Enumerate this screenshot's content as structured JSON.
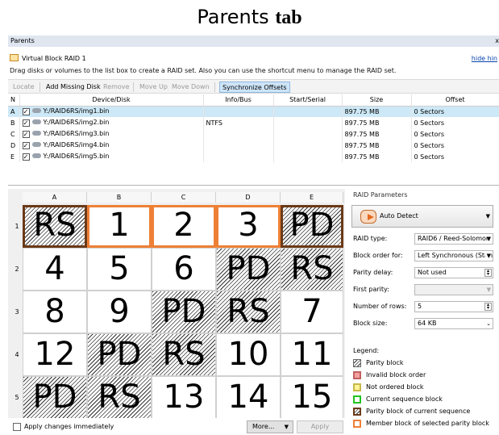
{
  "doc_title": {
    "part1": "Parents ",
    "part2": "tab"
  },
  "panel": {
    "title": "Parents",
    "close": "x"
  },
  "volume": {
    "name": "Virtual Block RAID 1",
    "hide_link": "hide hin"
  },
  "info_text": "Drag disks or volumes to the list box to create a RAID set. Also you can use the shortcut menu to manage the RAID set.",
  "toolbar": {
    "locate": "Locate",
    "add_missing": "Add Missing Disk",
    "remove": "Remove",
    "move_up": "Move Up",
    "move_down": "Move Down",
    "sync": "Synchronize Offsets"
  },
  "table": {
    "headers": {
      "n": "N",
      "device": "Device/Disk",
      "info": "Info/Bus",
      "start": "Start/Serial",
      "size": "Size",
      "offset": "Offset"
    },
    "rows": [
      {
        "n": "A",
        "device": "Y:/RAID6RS/img1.bin",
        "info": "",
        "start": "",
        "size": "897.75 MB",
        "offset": "0 Sectors"
      },
      {
        "n": "B",
        "device": "Y:/RAID6RS/img2.bin",
        "info": "NTFS",
        "start": "",
        "size": "897.75 MB",
        "offset": "0 Sectors"
      },
      {
        "n": "C",
        "device": "Y:/RAID6RS/img3.bin",
        "info": "",
        "start": "",
        "size": "897.75 MB",
        "offset": "0 Sectors"
      },
      {
        "n": "D",
        "device": "Y:/RAID6RS/img4.bin",
        "info": "",
        "start": "",
        "size": "897.75 MB",
        "offset": "0 Sectors"
      },
      {
        "n": "E",
        "device": "Y:/RAID6RS/img5.bin",
        "info": "",
        "start": "",
        "size": "897.75 MB",
        "offset": "0 Sectors"
      }
    ]
  },
  "grid": {
    "columns": [
      "A",
      "B",
      "C",
      "D",
      "E"
    ],
    "row_numbers": [
      "1",
      "2",
      "3",
      "4",
      "5"
    ],
    "rows": [
      [
        {
          "label": "RS",
          "kind": "curpar"
        },
        {
          "label": "1",
          "kind": "cur"
        },
        {
          "label": "2",
          "kind": "cur"
        },
        {
          "label": "3",
          "kind": "cur"
        },
        {
          "label": "PD",
          "kind": "curpar"
        }
      ],
      [
        {
          "label": "4",
          "kind": "data"
        },
        {
          "label": "5",
          "kind": "data"
        },
        {
          "label": "6",
          "kind": "data"
        },
        {
          "label": "PD",
          "kind": "parity"
        },
        {
          "label": "RS",
          "kind": "parity"
        }
      ],
      [
        {
          "label": "8",
          "kind": "data"
        },
        {
          "label": "9",
          "kind": "data"
        },
        {
          "label": "PD",
          "kind": "parity"
        },
        {
          "label": "RS",
          "kind": "parity"
        },
        {
          "label": "7",
          "kind": "data"
        }
      ],
      [
        {
          "label": "12",
          "kind": "data"
        },
        {
          "label": "PD",
          "kind": "parity"
        },
        {
          "label": "RS",
          "kind": "parity"
        },
        {
          "label": "10",
          "kind": "data"
        },
        {
          "label": "11",
          "kind": "data"
        }
      ],
      [
        {
          "label": "PD",
          "kind": "parity"
        },
        {
          "label": "RS",
          "kind": "parity"
        },
        {
          "label": "13",
          "kind": "data"
        },
        {
          "label": "14",
          "kind": "data"
        },
        {
          "label": "15",
          "kind": "data"
        }
      ]
    ]
  },
  "bottom": {
    "apply_immediately": "Apply changes immediately",
    "more": "More...",
    "apply": "Apply"
  },
  "params": {
    "title": "RAID Parameters",
    "auto_detect": "Auto Detect",
    "raid_type_label": "RAID type:",
    "raid_type_value": "RAID6 / Reed-Solomon",
    "block_order_label": "Block order for:",
    "block_order_value": "Left Synchronous (Stan",
    "parity_delay_label": "Parity delay:",
    "parity_delay_value": "Not used",
    "first_parity_label": "First parity:",
    "first_parity_value": "",
    "rows_label": "Number of rows:",
    "rows_value": "5",
    "block_size_label": "Block size:",
    "block_size_value": "64 KB"
  },
  "legend": {
    "title": "Legend:",
    "items": [
      {
        "text": "Parity block",
        "color": "#ffffff",
        "border": "#666666",
        "hatched": true
      },
      {
        "text": "Invalid block order",
        "color": "#f4a0a0",
        "border": "#c06060",
        "hatched": false
      },
      {
        "text": "Not ordered block",
        "color": "#fff59a",
        "border": "#c8b84a",
        "hatched": false
      },
      {
        "text": "Current sequence block",
        "color": "#ffffff",
        "border": "#22c422",
        "hatched": false
      },
      {
        "text": "Parity block of current sequence",
        "color": "#ffffff",
        "border": "#6b3a18",
        "hatched": true
      },
      {
        "text": "Member block of selected parity block",
        "color": "#ffffff",
        "border": "#ee8036",
        "hatched": false
      }
    ]
  },
  "colors": {
    "selected_row": "#cde8f6",
    "current_border": "#ee8036",
    "parity_current_border": "#6b3a18",
    "link": "#0645ad"
  }
}
